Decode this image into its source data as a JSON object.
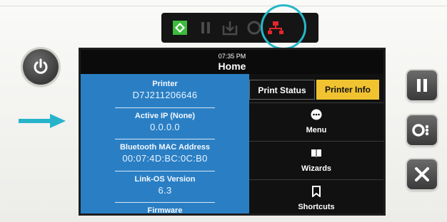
{
  "header": {
    "time": "07:35 PM",
    "title": "Home"
  },
  "printer_info": [
    {
      "label": "Printer",
      "value": "D7J211206646"
    },
    {
      "label": "Active IP (None)",
      "value": "0.0.0.0"
    },
    {
      "label": "Bluetooth MAC Address",
      "value": "00:07:4D:BC:0C:B0"
    },
    {
      "label": "Link-OS Version",
      "value": "6.3"
    },
    {
      "label": "Firmware",
      "value": ""
    }
  ],
  "tabs": {
    "status_label": "Print Status",
    "info_label": "Printer Info"
  },
  "menu_items": [
    {
      "label": "Menu",
      "icon": "menu-dots-icon"
    },
    {
      "label": "Wizards",
      "icon": "book-icon"
    },
    {
      "label": "Shortcuts",
      "icon": "bookmark-icon"
    }
  ],
  "indicators": [
    "status-icon",
    "pause-icon",
    "data-icon",
    "supplies-icon",
    "network-icon"
  ],
  "colors": {
    "panel_blue": "#2a7fc4",
    "accent_yellow": "#f1c331",
    "highlight_cyan": "#27b4cb",
    "network_red": "#e0262d",
    "status_green": "#3dbb3d"
  }
}
